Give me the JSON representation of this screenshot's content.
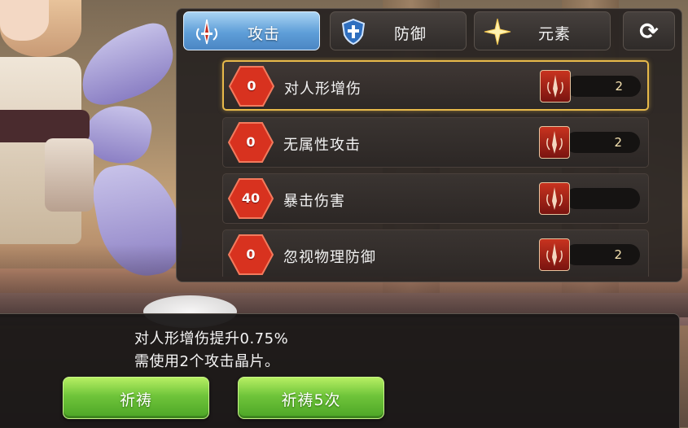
{
  "tabs": [
    {
      "label": "攻击",
      "icon": "sword-crest-icon",
      "active": true
    },
    {
      "label": "防御",
      "icon": "shield-icon",
      "active": false
    },
    {
      "label": "元素",
      "icon": "star-sparkle-icon",
      "active": false
    }
  ],
  "refresh": {
    "icon": "refresh-icon"
  },
  "stats": [
    {
      "value": "0",
      "name": "对人形增伤",
      "cost": "2",
      "selected": true
    },
    {
      "value": "0",
      "name": "无属性攻击",
      "cost": "2",
      "selected": false
    },
    {
      "value": "40",
      "name": "暴击伤害",
      "cost": "",
      "selected": false
    },
    {
      "value": "0",
      "name": "忽视物理防御",
      "cost": "2",
      "selected": false
    }
  ],
  "dialog": {
    "line1": "对人形增伤提升0.75%",
    "line2": "需使用2个攻击晶片。",
    "pray_label": "祈祷",
    "pray5_label": "祈祷5次"
  },
  "colors": {
    "accent_gold": "#e7b94a",
    "tab_active_blue": "#5e9ed8",
    "hex_red": "#d8321f",
    "button_green": "#6fc43a"
  }
}
